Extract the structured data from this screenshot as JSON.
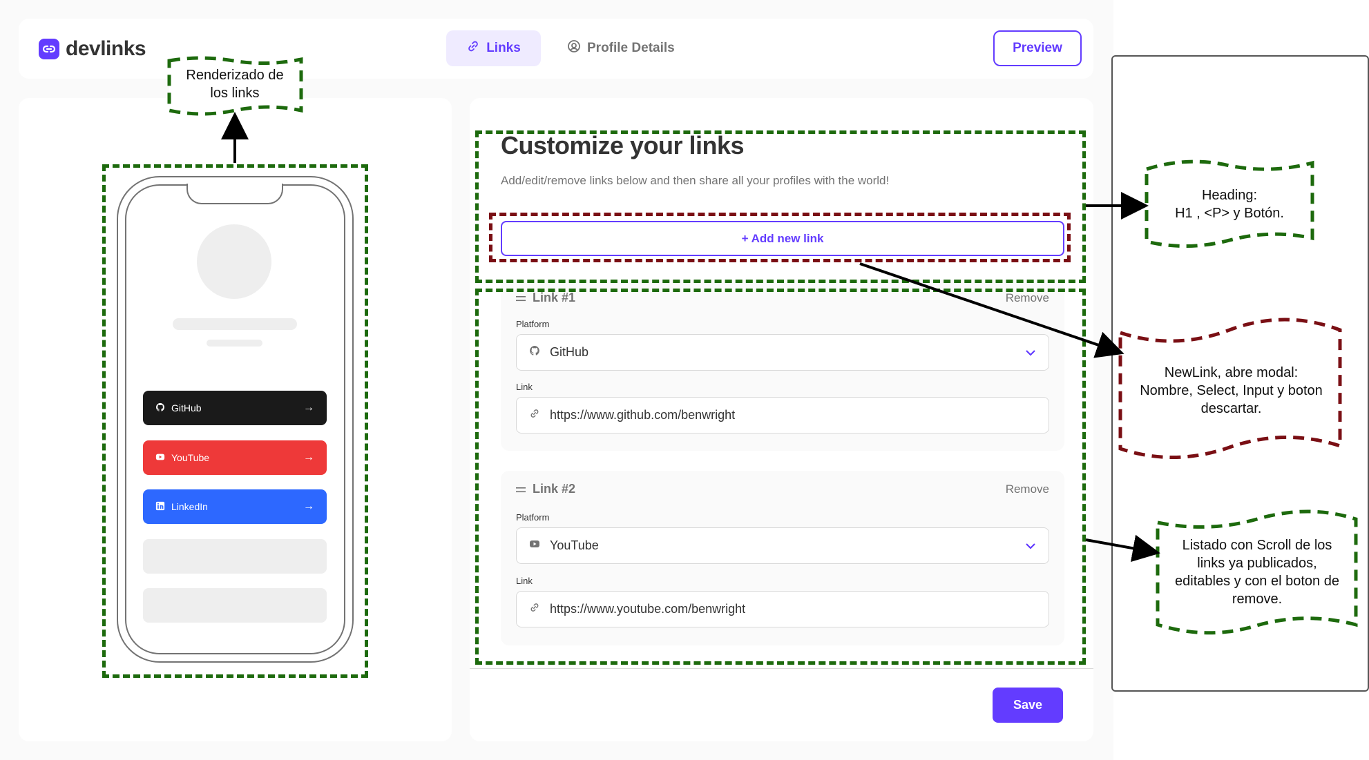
{
  "app": {
    "logo_text": "devlinks"
  },
  "nav": {
    "tab_links": "Links",
    "tab_profile": "Profile Details",
    "preview": "Preview"
  },
  "phone": {
    "links": [
      {
        "label": "GitHub",
        "color": "#1a1a1a"
      },
      {
        "label": "YouTube",
        "color": "#ee3939"
      },
      {
        "label": "LinkedIn",
        "color": "#2d68ff"
      }
    ]
  },
  "main": {
    "title": "Customize your links",
    "subtitle": "Add/edit/remove links below and then share all your profiles with the world!",
    "add_link": "+ Add new link",
    "links": [
      {
        "heading": "Link #1",
        "remove": "Remove",
        "platform_label": "Platform",
        "platform": "GitHub",
        "link_label": "Link",
        "url": "https://www.github.com/benwright"
      },
      {
        "heading": "Link #2",
        "remove": "Remove",
        "platform_label": "Platform",
        "platform": "YouTube",
        "link_label": "Link",
        "url": "https://www.youtube.com/benwright"
      }
    ],
    "save": "Save"
  },
  "annotations": {
    "render_links": [
      "Renderizado de",
      "los links"
    ],
    "heading": [
      "Heading:",
      "H1 , <P> y Botón."
    ],
    "newlink": [
      "NewLink, abre modal:",
      "Nombre, Select, Input y boton",
      "descartar."
    ],
    "list": [
      "Listado con Scroll de los",
      "links ya publicados,",
      "editables y con el boton de",
      "remove."
    ]
  },
  "colors": {
    "accent": "#633cff",
    "annotation_green": "#1d6a0d",
    "annotation_red": "#7a0f14"
  }
}
